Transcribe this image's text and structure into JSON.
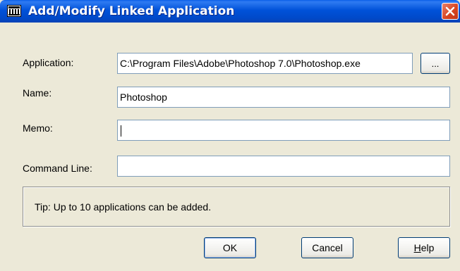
{
  "window": {
    "title": "Add/Modify Linked Application"
  },
  "form": {
    "application": {
      "label": "Application:",
      "value": "C:\\Program Files\\Adobe\\Photoshop 7.0\\Photoshop.exe"
    },
    "browse_label": "...",
    "name": {
      "label": "Name:",
      "value": "Photoshop"
    },
    "memo": {
      "label": "Memo:",
      "value": ""
    },
    "command_line": {
      "label": "Command Line:",
      "value": ""
    }
  },
  "tip": {
    "text": "Tip:  Up to 10 applications can be added."
  },
  "buttons": {
    "ok": "OK",
    "cancel": "Cancel",
    "help_accel": "H",
    "help_rest": "elp"
  },
  "icons": {
    "app": "application-icon",
    "close": "close-icon"
  },
  "colors": {
    "titlebar": "#0054E3",
    "dialog_bg": "#ECE9D8",
    "close": "#D6431F",
    "field_border": "#7F9DB9"
  }
}
